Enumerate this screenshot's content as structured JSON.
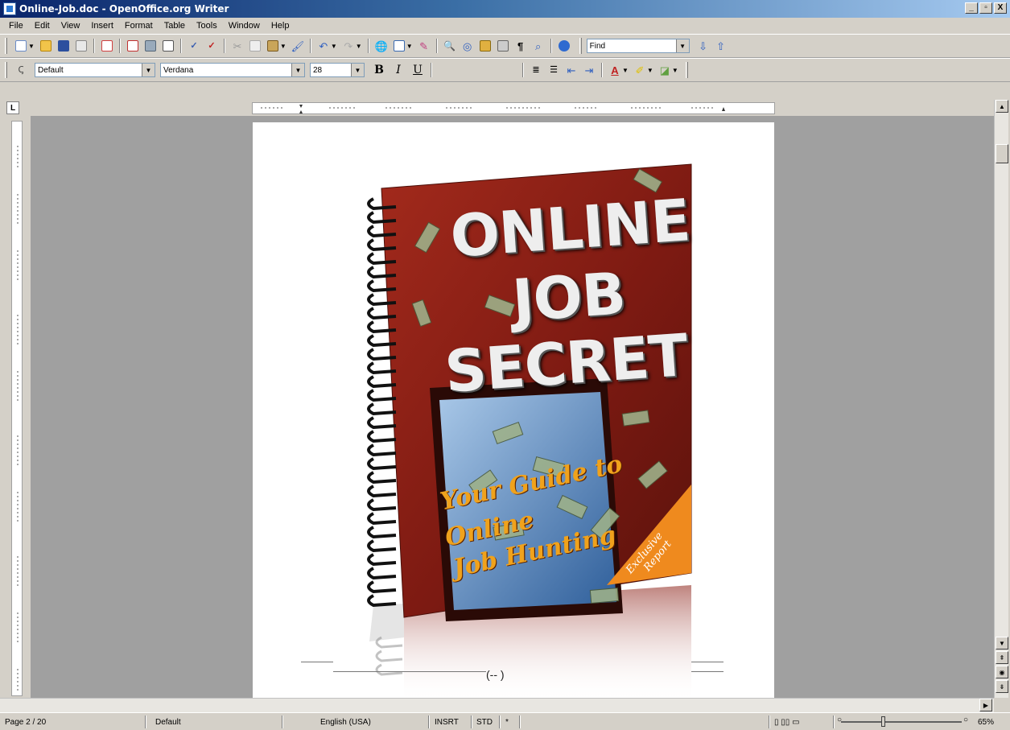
{
  "window": {
    "title": "Online-Job.doc - OpenOffice.org Writer",
    "minimize_label": "_",
    "maximize_label": "▫",
    "close_label": "X"
  },
  "menu": [
    "File",
    "Edit",
    "View",
    "Insert",
    "Format",
    "Table",
    "Tools",
    "Window",
    "Help"
  ],
  "toolbar": {
    "find_value": "Find",
    "style_value": "Default",
    "font_value": "Verdana",
    "size_value": "28",
    "bold_label": "B",
    "italic_label": "I",
    "underline_label": "U"
  },
  "document": {
    "cover": {
      "title_line1": "ONLINE",
      "title_line2": "JOB",
      "title_line3": "SECRET",
      "tagline_line1": "Your Guide to",
      "tagline_line2": "Online",
      "tagline_line3": "Job Hunting",
      "badge_line1": "Exclusive",
      "badge_line2": "Report"
    },
    "page_number": "(-- )"
  },
  "status": {
    "page": "Page 2 / 20",
    "style": "Default",
    "language": "English (USA)",
    "insert_mode": "INSRT",
    "selection_mode": "STD",
    "zoom": "65%"
  },
  "colors": {
    "titlebar_start": "#0a246a",
    "cover_red": "#8a1e14",
    "tagline_orange": "#f0a21c",
    "badge_orange": "#ef8a1e"
  }
}
